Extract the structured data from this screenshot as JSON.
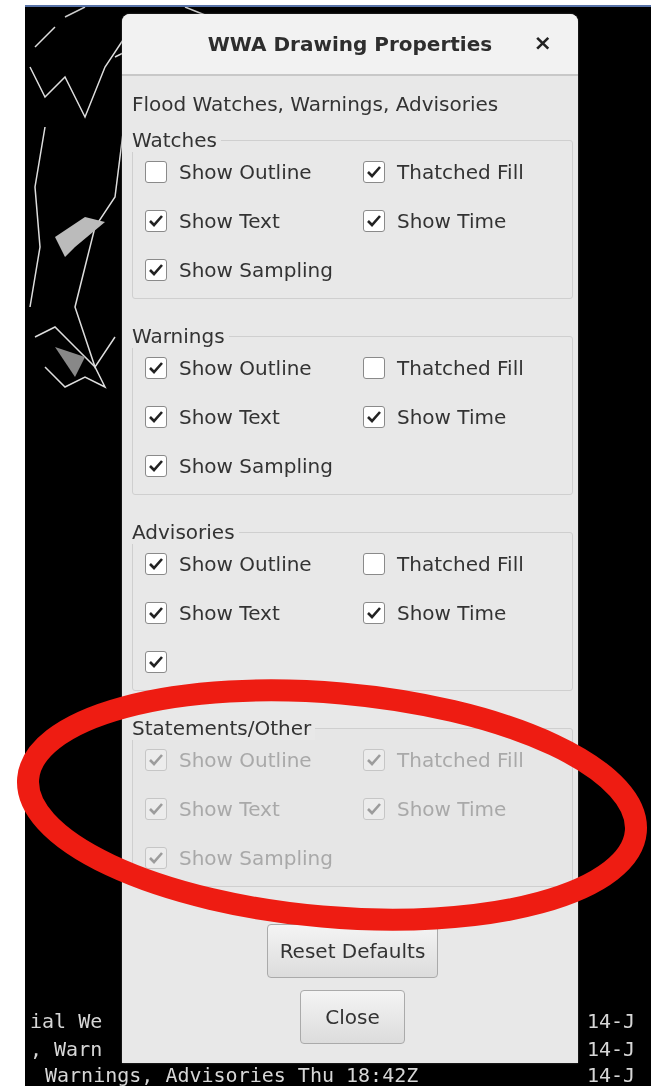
{
  "window": {
    "title": "WWA Drawing Properties",
    "close": "×"
  },
  "heading": "Flood Watches, Warnings, Advisories",
  "groups": [
    {
      "title": "Watches",
      "disabled": false,
      "items": [
        {
          "label": "Show Outline",
          "checked": false
        },
        {
          "label": "Thatched Fill",
          "checked": true
        },
        {
          "label": "Show Text",
          "checked": true
        },
        {
          "label": "Show Time",
          "checked": true
        },
        {
          "label": "Show Sampling",
          "checked": true
        }
      ]
    },
    {
      "title": "Warnings",
      "disabled": false,
      "items": [
        {
          "label": "Show Outline",
          "checked": true
        },
        {
          "label": "Thatched Fill",
          "checked": false
        },
        {
          "label": "Show Text",
          "checked": true
        },
        {
          "label": "Show Time",
          "checked": true
        },
        {
          "label": "Show Sampling",
          "checked": true
        }
      ]
    },
    {
      "title": "Advisories",
      "disabled": false,
      "items": [
        {
          "label": "Show Outline",
          "checked": true
        },
        {
          "label": "Thatched Fill",
          "checked": false
        },
        {
          "label": "Show Text",
          "checked": true
        },
        {
          "label": "Show Time",
          "checked": true
        },
        {
          "checked": true
        }
      ]
    },
    {
      "title": "Statements/Other",
      "disabled": true,
      "items": [
        {
          "label": "Show Outline",
          "checked": true
        },
        {
          "label": "Thatched Fill",
          "checked": true
        },
        {
          "label": "Show Text",
          "checked": true
        },
        {
          "label": "Show Time",
          "checked": true
        },
        {
          "label": "Show Sampling",
          "checked": true
        }
      ]
    }
  ],
  "buttons": [
    "Reset Defaults",
    "Close"
  ],
  "background_lines": [
    {
      "left": "ial We",
      "right": "14-J"
    },
    {
      "left": ", Warn",
      "right": "14-J"
    },
    {
      "left": "Warnings, Advisories Thu 18:42Z",
      "right": "14-J"
    }
  ]
}
